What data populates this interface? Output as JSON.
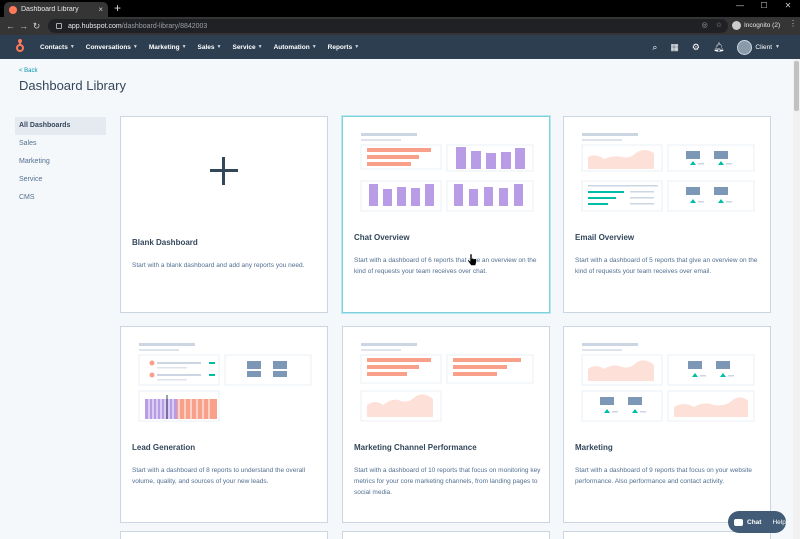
{
  "browser": {
    "tab_title": "Dashboard Library",
    "tab_close": "×",
    "new_tab": "+",
    "url_host": "app.hubspot.com",
    "url_path": "/dashboard-library/8842003",
    "profile": "Incognito (2)"
  },
  "nav": {
    "items": [
      {
        "label": "Contacts"
      },
      {
        "label": "Conversations"
      },
      {
        "label": "Marketing"
      },
      {
        "label": "Sales"
      },
      {
        "label": "Service"
      },
      {
        "label": "Automation"
      },
      {
        "label": "Reports"
      }
    ],
    "account": "Client"
  },
  "page": {
    "back": "< Back",
    "title": "Dashboard Library"
  },
  "sidebar": {
    "items": [
      {
        "label": "All Dashboards",
        "active": true
      },
      {
        "label": "Sales"
      },
      {
        "label": "Marketing"
      },
      {
        "label": "Service"
      },
      {
        "label": "CMS"
      }
    ]
  },
  "cards": [
    {
      "title": "Blank Dashboard",
      "description": "Start with a blank dashboard and add any reports you need."
    },
    {
      "title": "Chat Overview",
      "description": "Start with a dashboard of 6 reports that give an overview on the kind of requests your team receives over chat."
    },
    {
      "title": "Email Overview",
      "description": "Start with a dashboard of 5 reports that give an overview on the kind of requests your team receives over email."
    },
    {
      "title": "Lead Generation",
      "description": "Start with a dashboard of 8 reports to understand the overall volume, quality, and sources of your new leads."
    },
    {
      "title": "Marketing Channel Performance",
      "description": "Start with a dashboard of 10 reports that focus on monitoring key metrics for your core marketing channels, from landing pages to social media."
    },
    {
      "title": "Marketing",
      "description": "Start with a dashboard of 9 reports that focus on your website performance. Also performance and contact activity."
    }
  ],
  "chat": {
    "chat_label": "Chat",
    "help_label": "Help"
  },
  "colors": {
    "orange": "#f8a08a",
    "purple": "#b89ce6",
    "peach": "#fde0d7",
    "slate": "#7c98b6",
    "teal": "#00bda5"
  }
}
